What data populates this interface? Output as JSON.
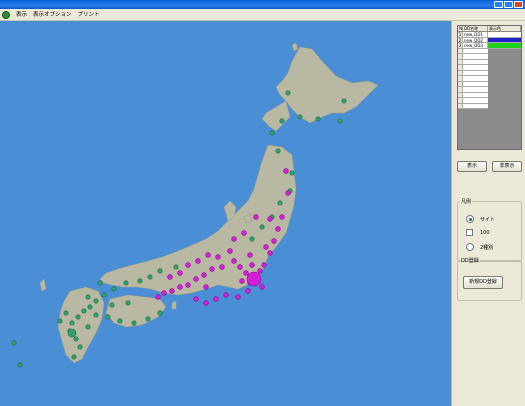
{
  "menu": {
    "items": [
      "表示",
      "表示オプション",
      "プリント"
    ]
  },
  "map": {
    "colors": {
      "sea": "#4a8fd6",
      "land": "#b9b8a2",
      "green_sites": "#2ea36a",
      "magenta_sites": "#d51ed8"
    }
  },
  "dd_table": {
    "headers": [
      "No",
      "DD名称",
      "表示色"
    ],
    "rows": [
      {
        "num": "1",
        "name": "new_DD1",
        "color": "#ffffff"
      },
      {
        "num": "2",
        "name": "new_DD2",
        "color": "#2220c8"
      },
      {
        "num": "3",
        "name": "new_DD3",
        "color": "#1fd21f"
      }
    ],
    "empty_row_count": 11
  },
  "buttons": {
    "show": "表示",
    "hide": "非表示"
  },
  "legend_group": {
    "title": "凡例",
    "options": [
      {
        "label": "サイト",
        "control": "radio",
        "selected": true
      },
      {
        "label": "100",
        "control": "checkbox",
        "selected": false
      },
      {
        "label": "2種別",
        "control": "radio",
        "selected": false
      }
    ]
  },
  "dd_register": {
    "title": "DD登録",
    "button": "新規DD登録"
  }
}
